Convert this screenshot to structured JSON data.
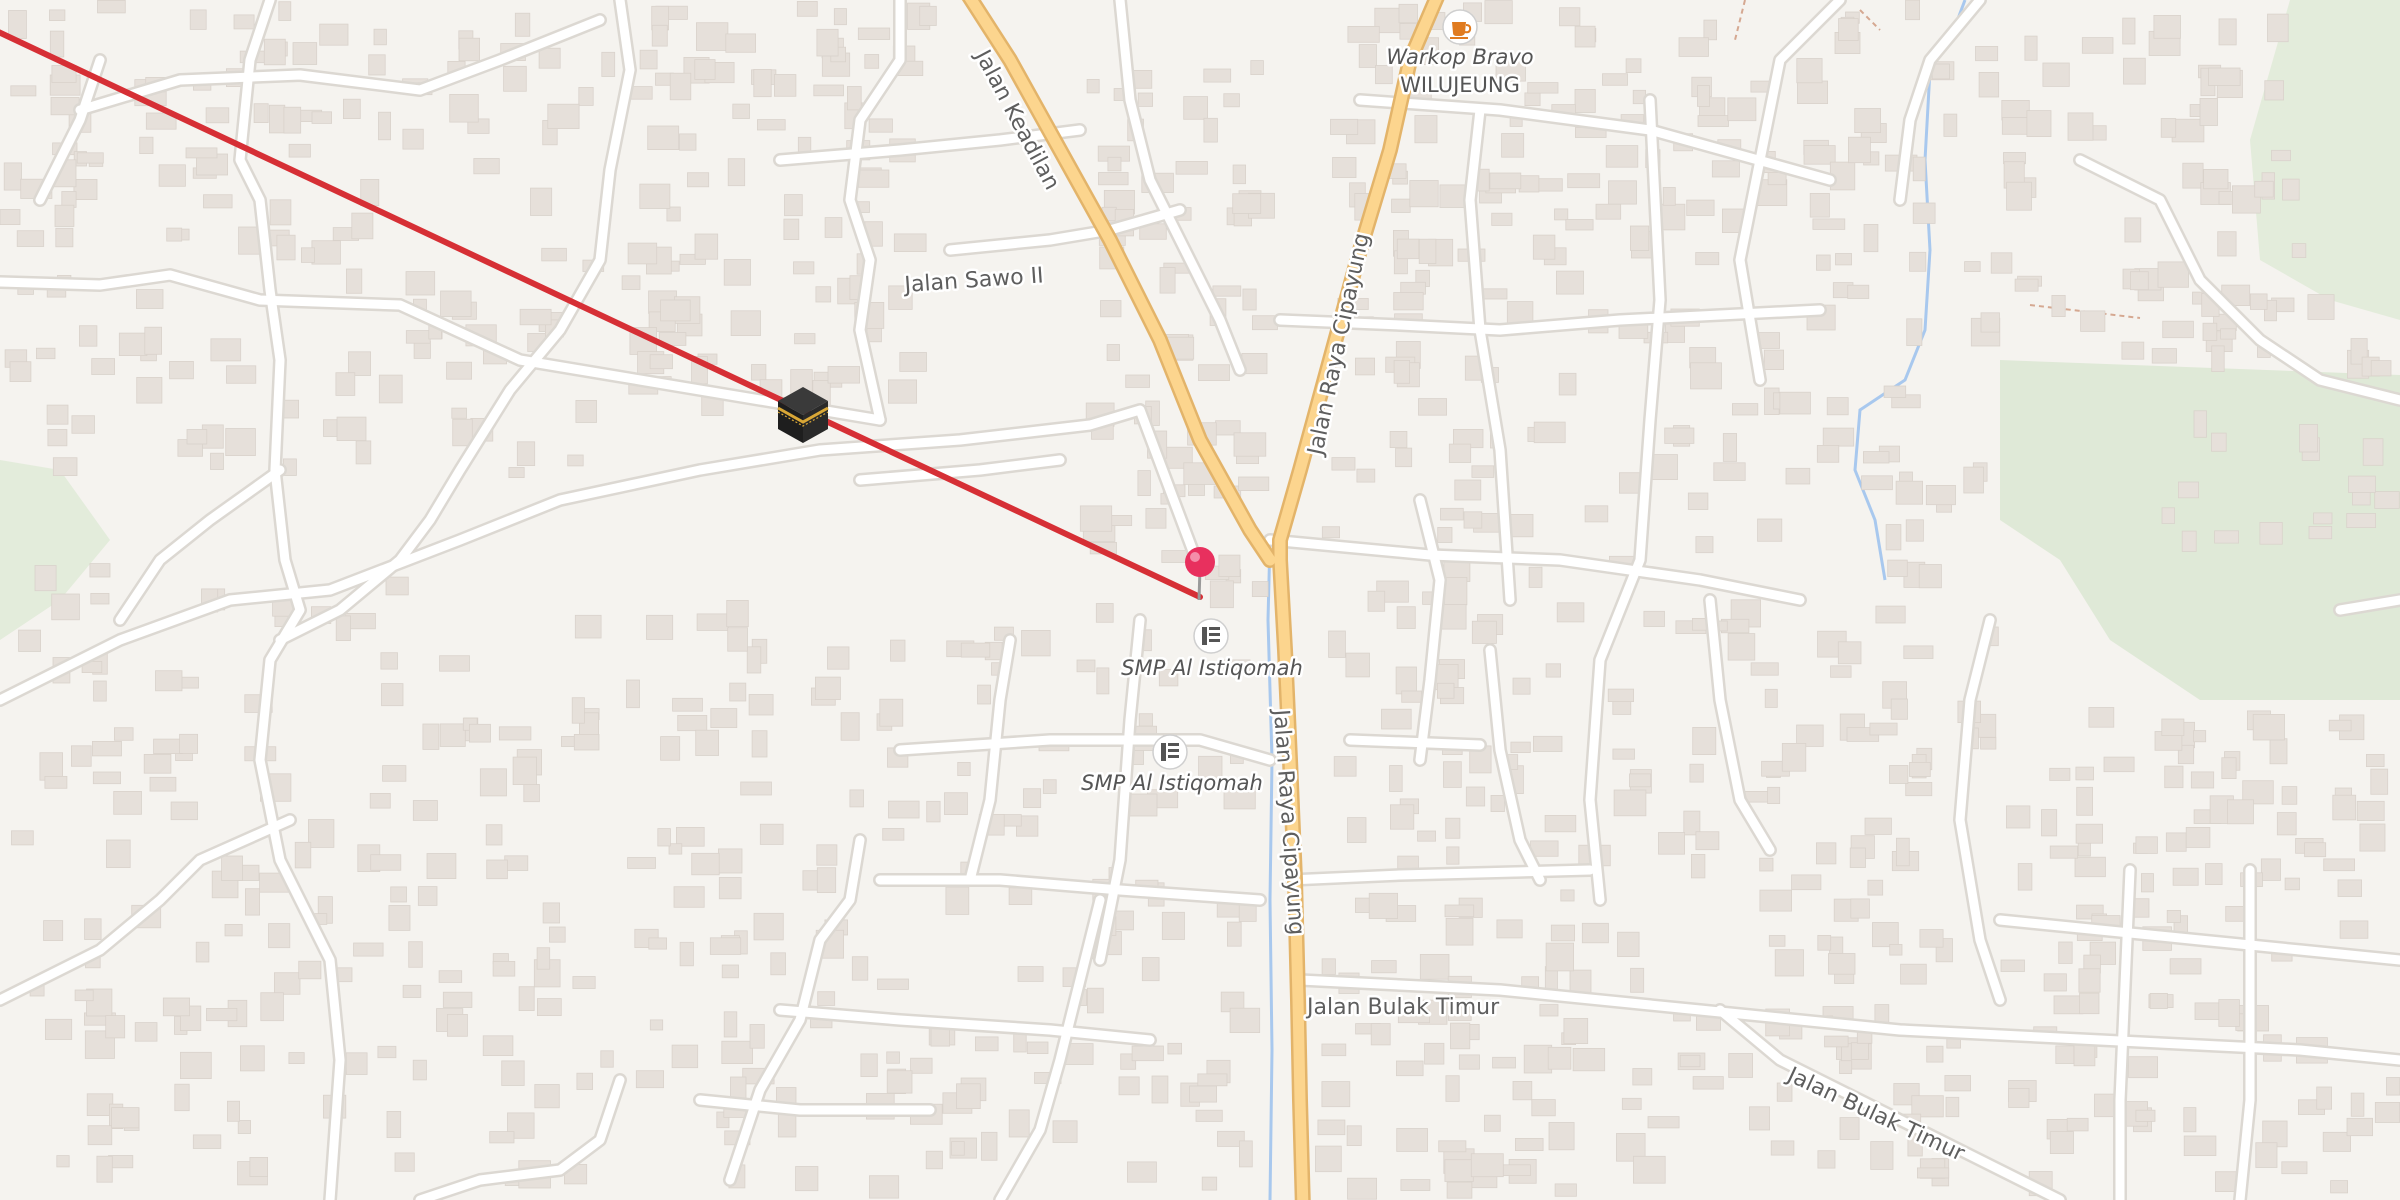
{
  "streets": {
    "keadilan": "Jalan Keadilan",
    "sawo": "Jalan Sawo II",
    "cipayung_north": "Jalan Raya Cipayung",
    "cipayung_south": "Jalan Raya Cipayung",
    "bulak_timur": "Jalan Bulak Timur",
    "bulak_timur_east": "Jalan Bulak Timur"
  },
  "pois": {
    "cafe": {
      "line1": "Warkop Bravo",
      "line2": "WILUJEUNG",
      "icon": "coffee-cup-icon"
    },
    "school_1": {
      "label": "SMP Al Istiqomah",
      "icon": "school-icon"
    },
    "school_2": {
      "label": "SMP Al Istiqomah",
      "icon": "school-icon"
    }
  },
  "markers": {
    "location_pin": {
      "icon": "map-pin-icon",
      "color": "#e8305e"
    },
    "qibla_target": {
      "icon": "kaaba-icon"
    }
  },
  "qibla_line": {
    "color": "#d62f35"
  },
  "colors": {
    "background": "#f5f3ef",
    "road": "#ffffff",
    "road_casing": "#dcd8d2",
    "main_road": "#fcd58e",
    "main_road_casing": "#e3b46a",
    "park": "#dfe9d7",
    "water": "#a8c8ee",
    "building": "#e6e0da"
  }
}
